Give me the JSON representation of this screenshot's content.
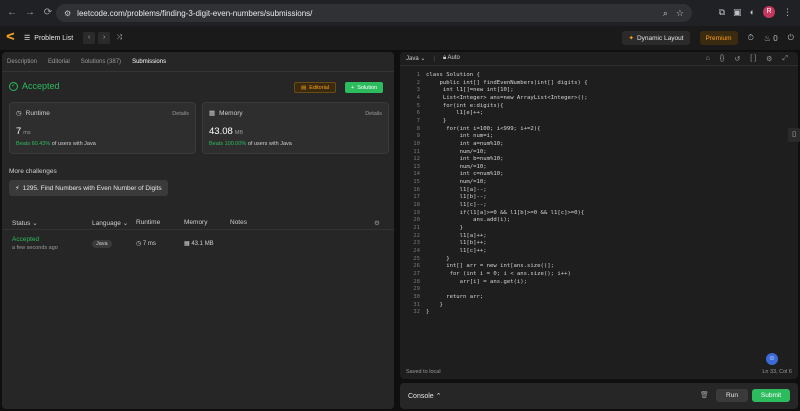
{
  "browser": {
    "url": "leetcode.com/problems/finding-3-digit-even-numbers/submissions/",
    "avatar": "R"
  },
  "topbar": {
    "problem_list": "Problem List",
    "dynamic_layout": "Dynamic Layout",
    "premium": "Premium",
    "streak": "0"
  },
  "left": {
    "tabs": [
      "Description",
      "Editorial",
      "Solutions (387)",
      "Submissions"
    ],
    "status": "Accepted",
    "editorial_btn": "Editorial",
    "solution_btn": "Solution",
    "runtime": {
      "label": "Runtime",
      "details": "Details",
      "value": "7",
      "unit": "ms",
      "beats_pct": "Beats 60.43%",
      "beats_rest": "of users with Java"
    },
    "memory": {
      "label": "Memory",
      "details": "Details",
      "value": "43.08",
      "unit": "MB",
      "beats_pct": "Beats 100.00%",
      "beats_rest": "of users with Java"
    },
    "more_challenges": "More challenges",
    "challenge": "1295. Find Numbers with Even Number of Digits",
    "table": {
      "headers": [
        "Status",
        "Language",
        "Runtime",
        "Memory",
        "Notes"
      ],
      "row": {
        "status": "Accepted",
        "time": "a few seconds ago",
        "language": "Java",
        "runtime": "7 ms",
        "memory": "43.1 MB"
      }
    }
  },
  "editor": {
    "language": "Java",
    "mode": "Auto",
    "saved": "Saved to local",
    "position": "Ln 33, Col 6",
    "lines": [
      "class Solution {",
      "    public int[] findEvenNumbers(int[] digits) {",
      "     int l1[]=new int[10];",
      "     List<Integer> ans=new ArrayList<Integer>();",
      "     for(int e:digits){",
      "         l1[e]++;",
      "     }",
      "      for(int i=100; i<999; i+=2){",
      "          int num=i;",
      "          int a=num%10;",
      "          num/=10;",
      "          int b=num%10;",
      "          num/=10;",
      "          int c=num%10;",
      "          num/=10;",
      "          l1[a]--;",
      "          l1[b]--;",
      "          l1[c]--;",
      "          if(l1[a]>=0 && l1[b]>=0 && l1[c]>=0){",
      "              ans.add(i);",
      "          }",
      "          l1[a]++;",
      "          l1[b]++;",
      "          l1[c]++;",
      "      }",
      "      int[] arr = new int[ans.size()];",
      "       for (int i = 0; i < ans.size(); i++)",
      "          arr[i] = ans.get(i);",
      "",
      "      return arr;",
      "    }",
      "}"
    ]
  },
  "console": {
    "label": "Console",
    "run": "Run",
    "submit": "Submit"
  }
}
